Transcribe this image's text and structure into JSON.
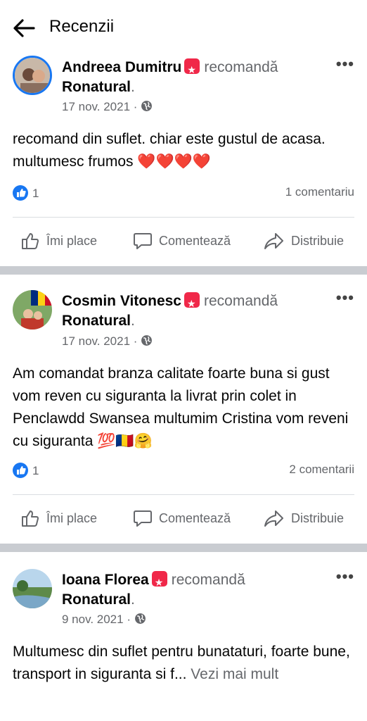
{
  "header": {
    "title": "Recenzii"
  },
  "posts": [
    {
      "author": "Andreea Dumitru",
      "verb": "recomandă",
      "page": "Ronatural",
      "dot": ".",
      "date": "17 nov. 2021 ·",
      "text": "recomand  din suflet.  chiar este gustul de acasa. multumesc frumos ❤️❤️❤️❤️",
      "likes": "1",
      "comments": "1 comentariu"
    },
    {
      "author": "Cosmin Vitonesc",
      "verb": "recomandă",
      "page": "Ronatural",
      "dot": ".",
      "date": "17 nov. 2021 ·",
      "text": "Am comandat branza calitate foarte buna si gust vom reven cu siguranta la livrat prin colet in Penclawdd Swansea multumim Cristina vom reveni cu siguranta 💯🇷🇴🤗",
      "likes": "1",
      "comments": "2 comentarii"
    },
    {
      "author": "Ioana Florea",
      "verb": "recomandă",
      "page": "Ronatural",
      "dot": ".",
      "date": "9 nov. 2021 ·",
      "text": "Multumesc din suflet pentru bunataturi, foarte bune, transport in siguranta si f...",
      "see_more": "Vezi mai mult"
    }
  ],
  "actions": {
    "like": "Îmi place",
    "comment": "Comentează",
    "share": "Distribuie"
  },
  "more_menu": "•••",
  "icons": [
    "back-arrow-icon",
    "recommend-badge-icon",
    "globe-icon",
    "like-reaction-icon",
    "thumbs-up-icon",
    "comment-icon",
    "share-icon",
    "more-options-icon"
  ],
  "colors": {
    "accent": "#1877f2",
    "badge": "#f02849",
    "separator": "#c9ccd1"
  }
}
